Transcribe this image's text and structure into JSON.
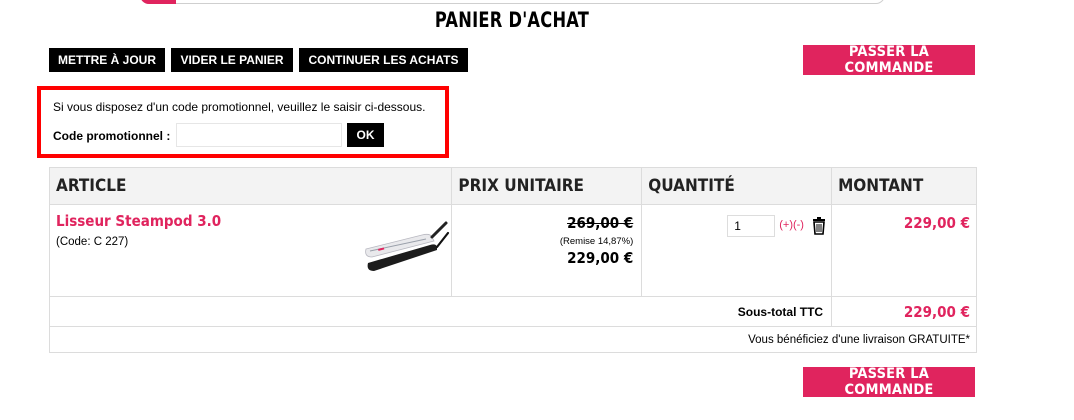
{
  "page": {
    "title": "PANIER D'ACHAT"
  },
  "toolbar": {
    "update_label": "METTRE À JOUR",
    "empty_label": "VIDER LE PANIER",
    "continue_label": "CONTINUER LES ACHATS",
    "checkout_label": "PASSER LA COMMANDE"
  },
  "promo": {
    "intro": "Si vous disposez d'un code promotionnel, veuillez le saisir ci-dessous.",
    "label": "Code promotionnel :",
    "value": "",
    "ok_label": "OK"
  },
  "table": {
    "headers": [
      "ARTICLE",
      "PRIX UNITAIRE",
      "QUANTITÉ",
      "MONTANT"
    ],
    "items": [
      {
        "name": "Lisseur Steampod 3.0",
        "code": "(Code: C 227)",
        "old_price": "269,00 €",
        "discount": "(Remise 14,87%)",
        "price": "229,00 €",
        "quantity": "1",
        "qty_controls": "(+)(-)",
        "amount": "229,00 €"
      }
    ],
    "subtotal_label": "Sous-total TTC",
    "subtotal_value": "229,00 €",
    "shipping_note": "Vous bénéficiez d'une livraison GRATUITE*"
  },
  "icons": {
    "delete": "trash-icon"
  },
  "colors": {
    "accent": "#e0245e",
    "highlight_border": "#ff0000",
    "button": "#000000"
  }
}
